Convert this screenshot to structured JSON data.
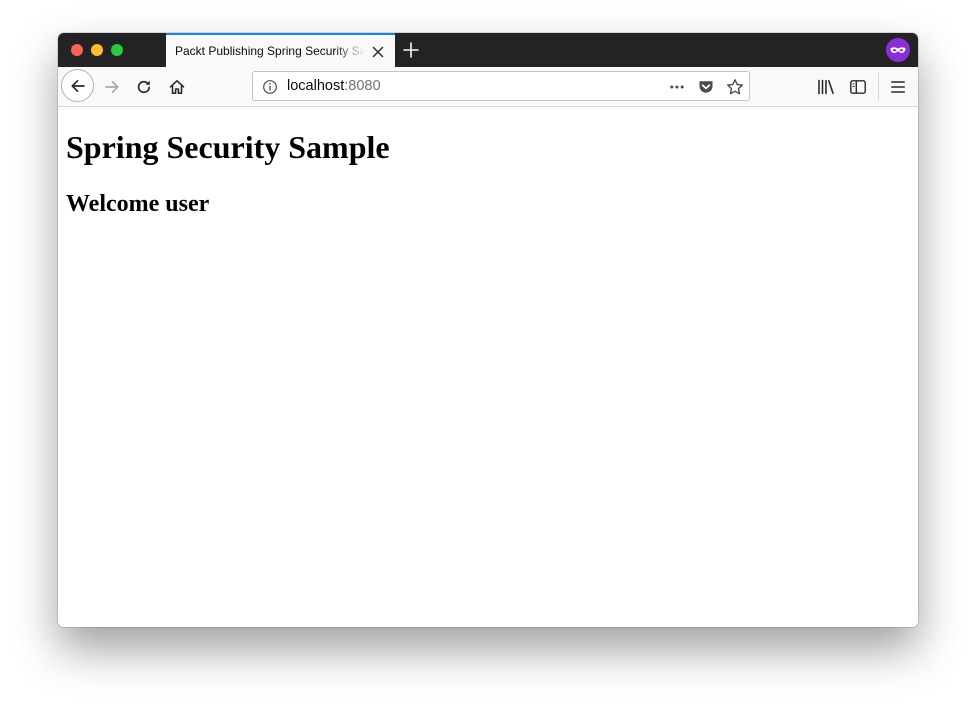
{
  "browser": {
    "tab": {
      "title": "Packt Publishing Spring Security Sample"
    },
    "address_bar": {
      "host": "localhost",
      "port": ":8080"
    },
    "icons": [
      "window-close-icon",
      "window-minimize-icon",
      "window-maximize-icon",
      "tab-close-icon",
      "new-tab-icon",
      "private-browsing-icon",
      "back-arrow-icon",
      "forward-arrow-icon",
      "reload-icon",
      "home-icon",
      "info-icon",
      "page-actions-icon",
      "pocket-icon",
      "bookmark-star-icon",
      "library-icon",
      "sidebar-icon",
      "menu-icon"
    ]
  },
  "page": {
    "heading": "Spring Security Sample",
    "subheading": "Welcome user"
  },
  "colors": {
    "tab_accent": "#0a84ff",
    "titlebar": "#232325",
    "private_badge": "#8a2ed7"
  }
}
